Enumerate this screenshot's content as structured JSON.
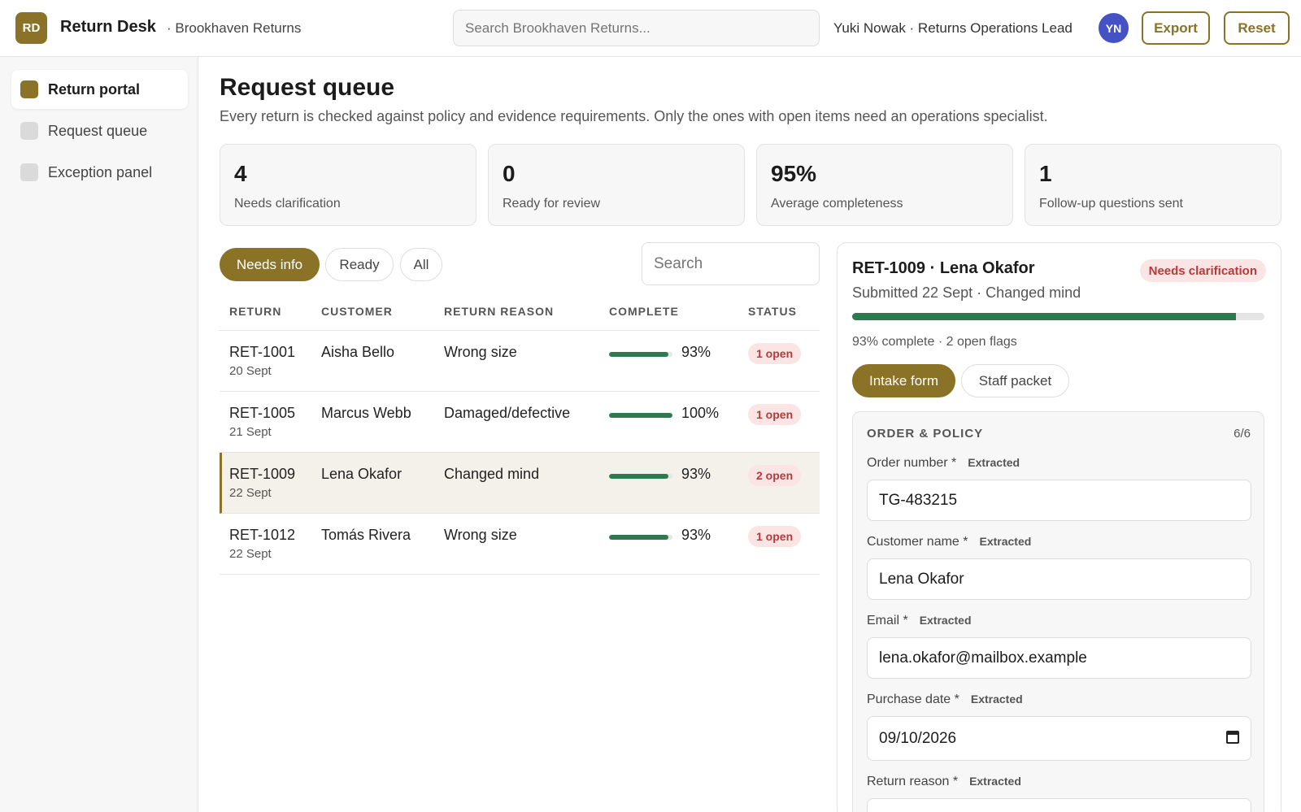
{
  "app": {
    "logo_initials": "RD",
    "title": "Return Desk",
    "org": "· Brookhaven Returns",
    "search_placeholder": "Search Brookhaven Returns...",
    "user": "Yuki Nowak · Returns Operations Lead",
    "user_initials": "YN",
    "export_label": "Export",
    "reset_label": "Reset"
  },
  "sidebar": {
    "items": [
      {
        "label": "Return portal"
      },
      {
        "label": "Request queue"
      },
      {
        "label": "Exception panel"
      }
    ]
  },
  "main": {
    "title": "Request queue",
    "subtitle": "Every return is checked against policy and evidence requirements. Only the ones with open items need an operations specialist.",
    "stats": [
      {
        "value": "4",
        "label": "Needs clarification"
      },
      {
        "value": "0",
        "label": "Ready for review"
      },
      {
        "value": "95%",
        "label": "Average completeness"
      },
      {
        "value": "1",
        "label": "Follow-up questions sent"
      }
    ],
    "filters": [
      "Needs info",
      "Ready",
      "All"
    ],
    "search_placeholder": "Search",
    "columns": [
      "RETURN",
      "CUSTOMER",
      "RETURN REASON",
      "COMPLETE",
      "STATUS"
    ],
    "rows": [
      {
        "id": "RET-1001",
        "date": "20 Sept",
        "customer": "Aisha Bello",
        "reason": "Wrong size",
        "complete": "93%",
        "complete_frac": 0.93,
        "status": "1 open"
      },
      {
        "id": "RET-1005",
        "date": "21 Sept",
        "customer": "Marcus Webb",
        "reason": "Damaged/defective",
        "complete": "100%",
        "complete_frac": 1.0,
        "status": "1 open"
      },
      {
        "id": "RET-1009",
        "date": "22 Sept",
        "customer": "Lena Okafor",
        "reason": "Changed mind",
        "complete": "93%",
        "complete_frac": 0.93,
        "status": "2 open"
      },
      {
        "id": "RET-1012",
        "date": "22 Sept",
        "customer": "Tomás Rivera",
        "reason": "Wrong size",
        "complete": "93%",
        "complete_frac": 0.93,
        "status": "1 open"
      }
    ]
  },
  "detail": {
    "title": "RET-1009 · Lena Okafor",
    "badge": "Needs clarification",
    "subtitle": "Submitted 22 Sept · Changed mind",
    "complete_frac": 0.93,
    "stats": "93% complete · 2 open flags",
    "tabs": [
      "Intake form",
      "Staff packet"
    ],
    "section": {
      "title": "ORDER & POLICY",
      "count": "6/6",
      "fields": [
        {
          "label": "Order number *",
          "tag": "Extracted",
          "value": "TG-483215"
        },
        {
          "label": "Customer name *",
          "tag": "Extracted",
          "value": "Lena Okafor"
        },
        {
          "label": "Email *",
          "tag": "Extracted",
          "value": "lena.okafor@mailbox.example"
        },
        {
          "label": "Purchase date *",
          "tag": "Extracted",
          "value": "09/10/2026"
        },
        {
          "label": "Return reason *",
          "tag": "Extracted",
          "value": ""
        }
      ]
    }
  },
  "colors": {
    "accent": "#8a7226",
    "progress": "#2e7a4f",
    "alert_bg": "#fae4e4",
    "alert_text": "#b73a3a",
    "avatar": "#4452c4"
  }
}
